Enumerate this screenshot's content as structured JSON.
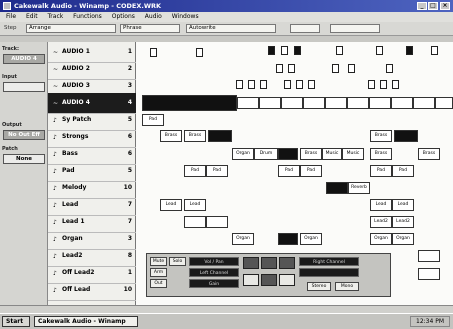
{
  "window": {
    "title": "Cakewalk Audio - Winamp - CODEX.WRK"
  },
  "menu": [
    "File",
    "Edit",
    "Track",
    "Functions",
    "Options",
    "Audio",
    "Windows"
  ],
  "toolbar": {
    "label_left": "Step",
    "field_left": "Arrange",
    "field_mid": "Phrase",
    "field_right": "Autowrite"
  },
  "inspector": {
    "track_label": "Track:",
    "track_value": "AUDIO 4",
    "input_label": "Input",
    "output_label": "Output",
    "out_value": "No Out Eff",
    "patch_label": "Patch",
    "patch_value": "None"
  },
  "tracks": [
    {
      "name": "AUDIO 1",
      "num": "1",
      "icon": "~"
    },
    {
      "name": "AUDIO 2",
      "num": "2",
      "icon": "~"
    },
    {
      "name": "AUDIO 3",
      "num": "3",
      "icon": "~"
    },
    {
      "name": "AUDIO 4",
      "num": "4",
      "icon": "~",
      "selected": true
    },
    {
      "name": "Sy Patch",
      "num": "5",
      "icon": "♪"
    },
    {
      "name": "Strongs",
      "num": "6",
      "icon": "♪"
    },
    {
      "name": "Bass",
      "num": "6",
      "icon": "♪"
    },
    {
      "name": "Pad",
      "num": "5",
      "icon": "♪"
    },
    {
      "name": "Melody",
      "num": "10",
      "icon": "♪"
    },
    {
      "name": "Lead",
      "num": "7",
      "icon": "♪"
    },
    {
      "name": "Lead 1",
      "num": "7",
      "icon": "♪"
    },
    {
      "name": "Organ",
      "num": "3",
      "icon": "♪"
    },
    {
      "name": "Lead2",
      "num": "8",
      "icon": "♪"
    },
    {
      "name": "Off Lead2",
      "num": "1",
      "icon": "♪"
    },
    {
      "name": "Off Lead",
      "num": "10",
      "icon": "♪"
    }
  ],
  "clips": {
    "pad": "Pad",
    "strings": "Strings",
    "bass": "Bass",
    "drum": "Drum",
    "lead": "Lead",
    "lead2": "Lead2",
    "organ": "Organ",
    "melody": "Melody",
    "brass": "Brass",
    "music": "Music",
    "reverb": "Reverb"
  },
  "faders": {
    "left_btns": [
      "Mute",
      "Solo",
      "Arm",
      "Out"
    ],
    "display_top": "Vol / Pan",
    "display_left": "Left Channel",
    "display_right": "Right Channel",
    "display_mid": "Gain",
    "btn_stereo": "Stereo",
    "btn_mono": "Mono"
  },
  "taskbar": {
    "start": "Start",
    "task": "Cakewalk Audio - Winamp",
    "clock": "12:34 PM"
  },
  "colors": {
    "titlebar": "#1e2a8c",
    "selected_track": "#1c1c1c"
  }
}
